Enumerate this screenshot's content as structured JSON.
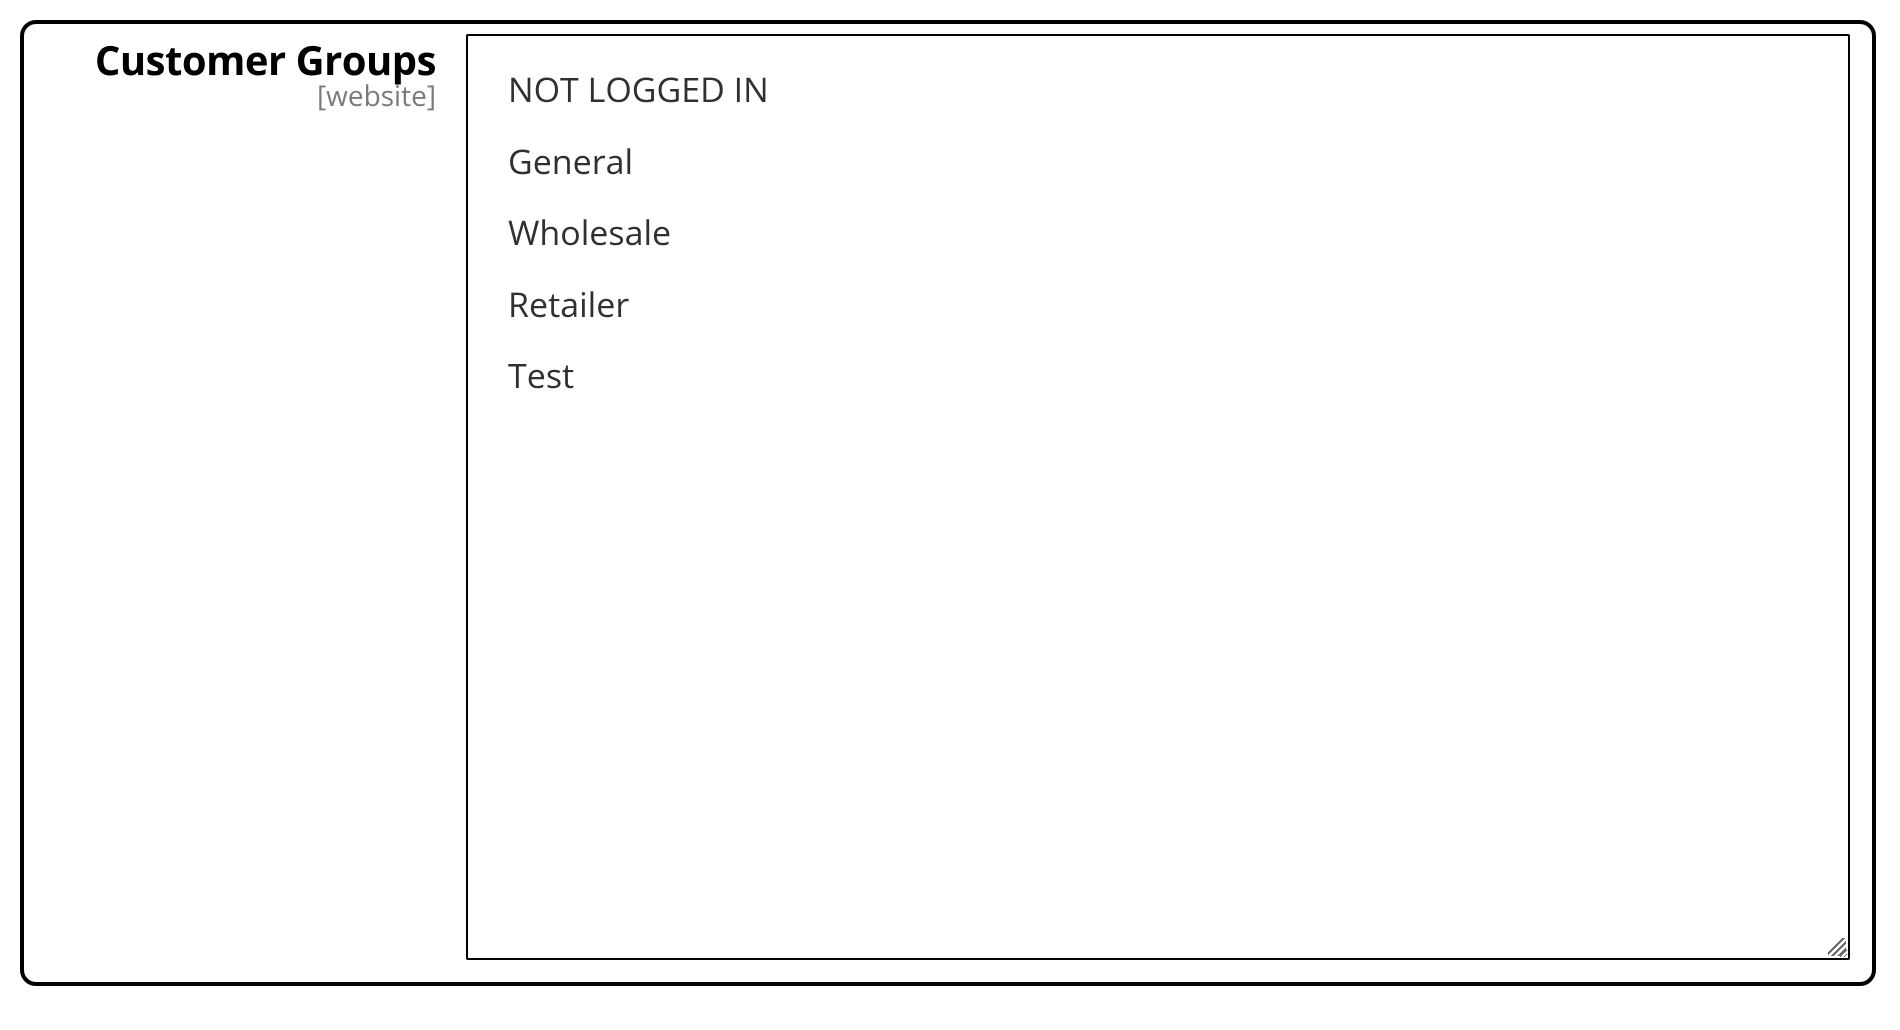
{
  "field": {
    "label": "Customer Groups",
    "scope": "[website]",
    "options": [
      "NOT LOGGED IN",
      "General",
      "Wholesale",
      "Retailer",
      "Test"
    ]
  }
}
